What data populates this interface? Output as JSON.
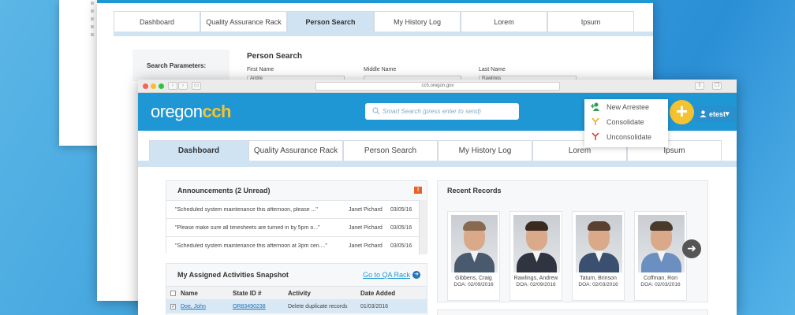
{
  "back_window": {
    "tabs": [
      "Dashboard",
      "Quality Assurance Rack",
      "Person Search",
      "My History Log",
      "Lorem",
      "Ipsum"
    ],
    "active_tab": 2,
    "search_parameters_label": "Search Parameters:",
    "title": "Person Search",
    "fields": [
      {
        "label": "First Name",
        "value": "Andre"
      },
      {
        "label": "Middle Name",
        "value": ""
      },
      {
        "label": "Last Name",
        "value": "Rawlings"
      }
    ]
  },
  "browser": {
    "url": "cch.oregon.gov"
  },
  "header": {
    "logo_part1": "oregon",
    "logo_part2": "cch",
    "search_placeholder": "Smart Search (press enter to send)",
    "add_symbol": "+",
    "user": "etest",
    "user_caret": "▾",
    "brand_color": "#1f97d4",
    "accent_color": "#f5c330"
  },
  "add_menu": [
    {
      "label": "New Arrestee",
      "icon": "add-person-icon"
    },
    {
      "label": "Consolidate",
      "icon": "merge-icon"
    },
    {
      "label": "Unconsolidate",
      "icon": "split-icon"
    }
  ],
  "tabs": [
    "Dashboard",
    "Quality Assurance Rack",
    "Person Search",
    "My History Log",
    "Lorem",
    "Ipsum"
  ],
  "active_tab": 0,
  "announcements": {
    "title": "Announcements (2 Unread)",
    "flag": "!",
    "items": [
      {
        "message": "\"Scheduled system maintenance this afternoon, please ...\"",
        "author": "Janet Pichard",
        "date": "03/05/16"
      },
      {
        "message": "\"Please make sure all timesheets are turned in by 5pm o...\"",
        "author": "Janet Pichard",
        "date": "03/05/16"
      },
      {
        "message": "\"Scheduled system maintenance this afternoon at 3pm cen....\"",
        "author": "Janet Pichard",
        "date": "03/05/16"
      }
    ]
  },
  "activities": {
    "title": "My Assigned Activities Snapshot",
    "link": "Go to QA Rack",
    "link_arrow": "➜",
    "columns": [
      "Name",
      "State ID #",
      "Activity",
      "Date Added"
    ],
    "rows": [
      {
        "checked": "✓",
        "name": "Doe, John",
        "state_id": "OR83490238",
        "activity": "Delete duplicate records",
        "date": "01/03/2016"
      }
    ]
  },
  "recent_records": {
    "title": "Recent Records",
    "next_symbol": "➜",
    "people": [
      {
        "name": "Gibbens, Craig",
        "doa": "DOA: 02/09/2016",
        "hair": "#8a6a4e",
        "shirt": "#4a5a6e"
      },
      {
        "name": "Rawlings, Andrew",
        "doa": "DOA: 02/09/2016",
        "hair": "#3a2a20",
        "shirt": "#2f3440"
      },
      {
        "name": "Tatum, Brinson",
        "doa": "DOA: 02/03/2016",
        "hair": "#5a4030",
        "shirt": "#3b4f70"
      },
      {
        "name": "Coffman, Ron",
        "doa": "DOA: 02/03/2016",
        "hair": "#4a3a2a",
        "shirt": "#6a8fc0"
      }
    ]
  }
}
